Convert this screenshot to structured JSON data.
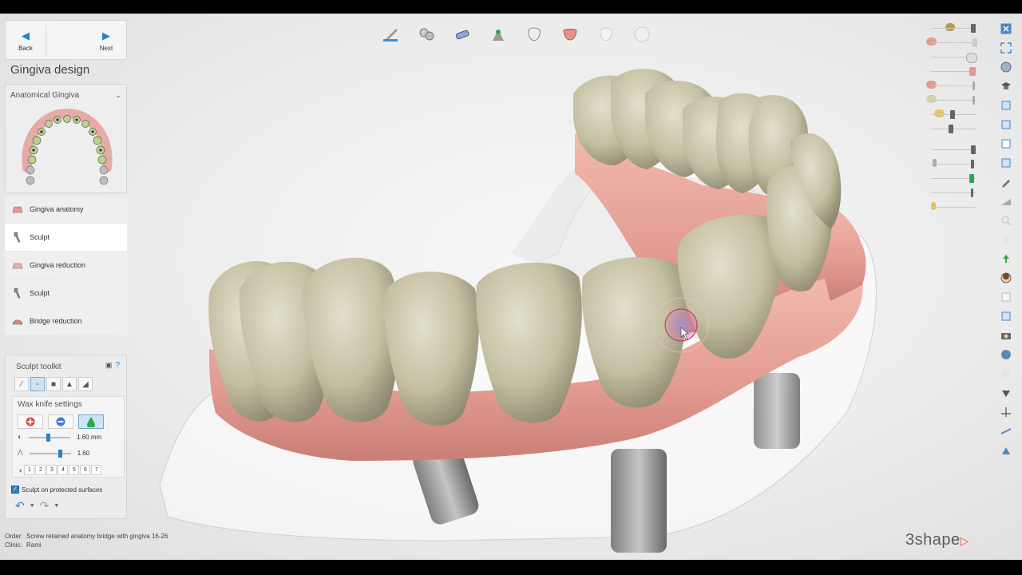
{
  "nav": {
    "back_label": "Back",
    "next_label": "Next"
  },
  "panel": {
    "title": "Gingiva design",
    "dropdown_value": "Anatomical Gingiva"
  },
  "steps": [
    {
      "label": "Gingiva anatomy",
      "icon": "gingiva-anatomy-icon",
      "active": false
    },
    {
      "label": "Sculpt",
      "icon": "sculpt-icon",
      "active": true
    },
    {
      "label": "Gingiva reduction",
      "icon": "gingiva-reduction-icon",
      "active": false
    },
    {
      "label": "Sculpt",
      "icon": "sculpt-icon",
      "active": false
    },
    {
      "label": "Bridge reduction",
      "icon": "bridge-reduction-icon",
      "active": false
    }
  ],
  "toolkit": {
    "title": "Sculpt toolkit",
    "help": "?",
    "wax_title": "Wax knife settings",
    "size_value": "1.60 mm",
    "strength_value": "1.60",
    "numbers": [
      "1",
      "2",
      "3",
      "4",
      "5",
      "6",
      "7"
    ],
    "protect_label": "Sculpt on protected surfaces"
  },
  "order": {
    "order_label": "Order:",
    "order_value": "Screw retained anatomy bridge with gingiva 16-26",
    "clinic_label": "Clinic:",
    "clinic_value": "Rami"
  },
  "brand": "3shape",
  "colors": {
    "accent": "#2b80c5",
    "gingiva": "#e9a39a",
    "tooth": "#cfcbb2",
    "brand_triangle": "#e0534a"
  }
}
